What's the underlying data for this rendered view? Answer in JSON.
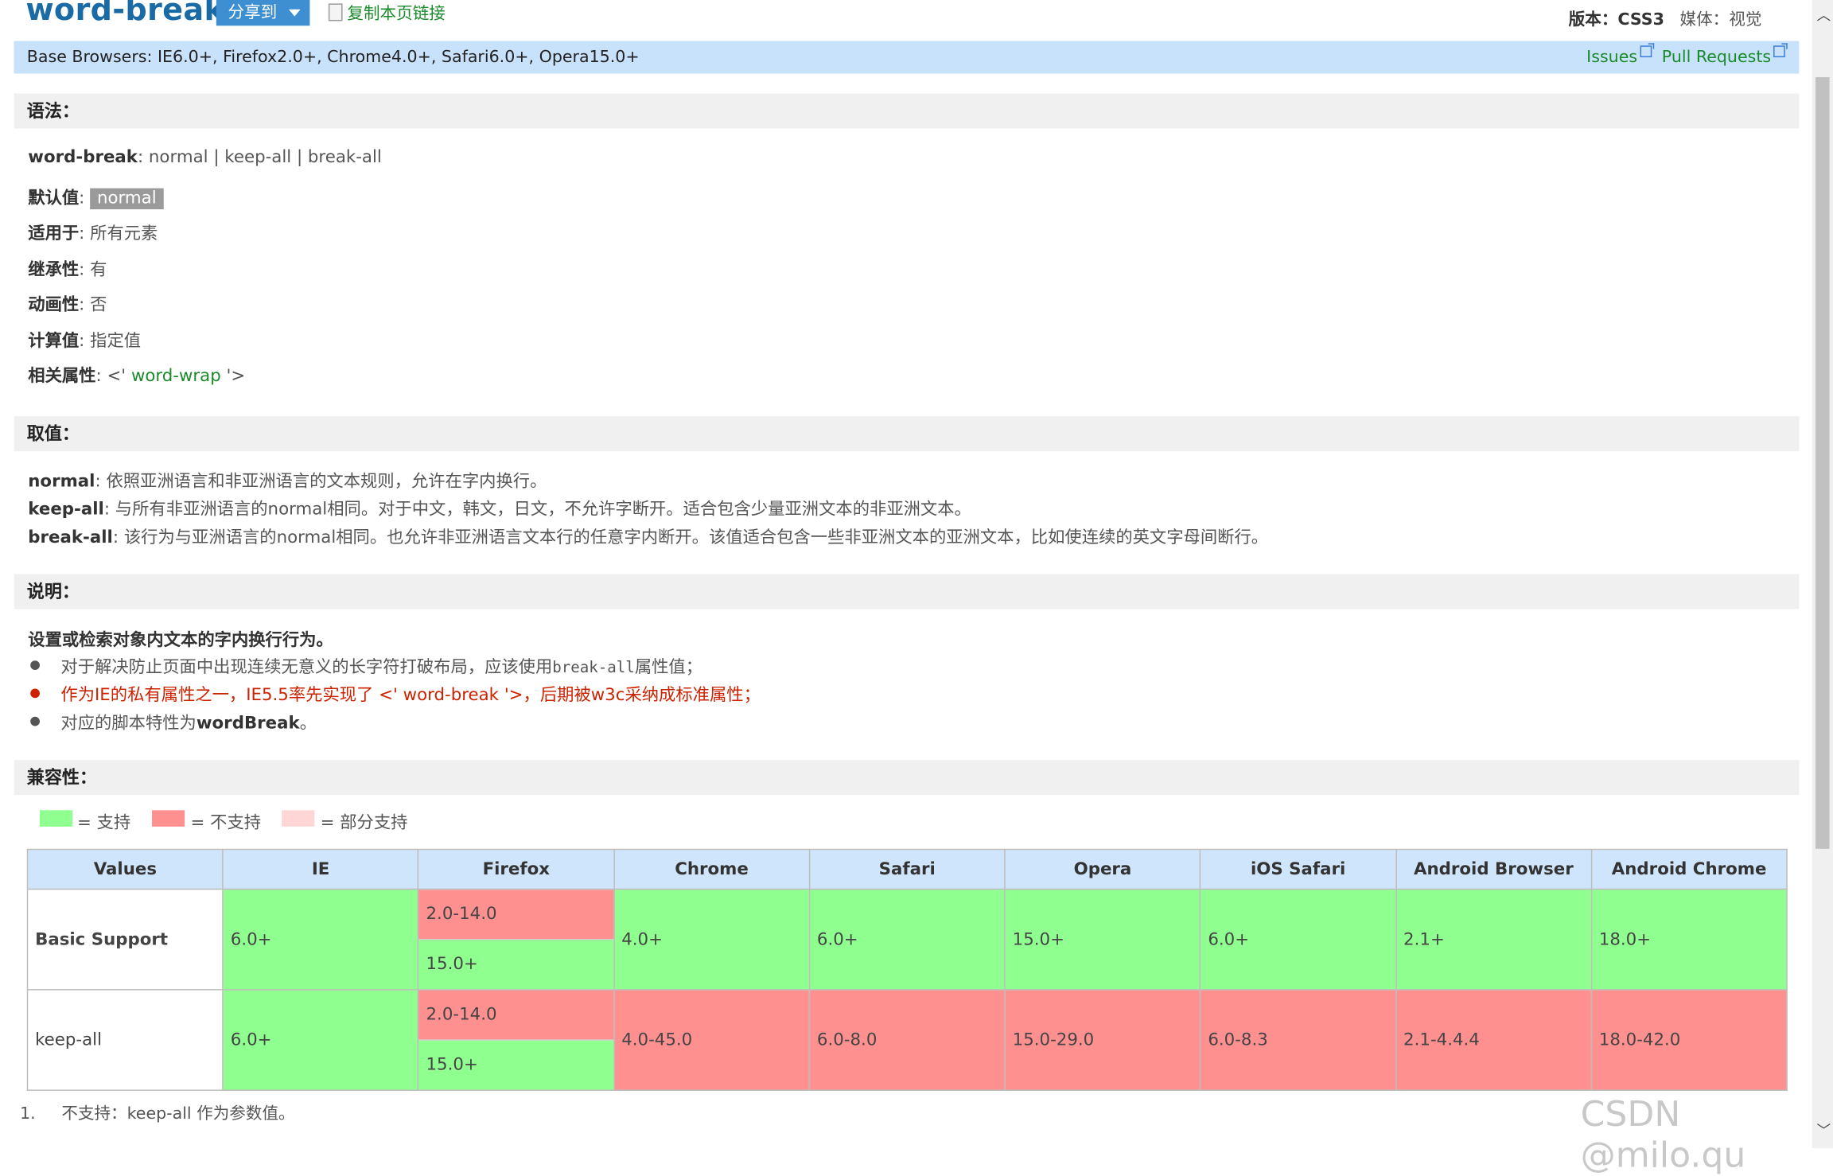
{
  "header": {
    "title": "word-break",
    "share_label": "分享到",
    "copy_link_label": "复制本页链接",
    "version_label": "版本：",
    "version_value": "CSS3",
    "media_label": "媒体：",
    "media_value": "视觉"
  },
  "browser_bar": {
    "base": "Base Browsers: IE6.0+, Firefox2.0+, Chrome4.0+, Safari6.0+, Opera15.0+",
    "issues": "Issues",
    "pull_requests": "Pull Requests"
  },
  "syntax": {
    "heading": "语法：",
    "prop_name": "word-break",
    "prop_values": ": normal | keep-all | break-all",
    "default_label": "默认值",
    "default_value": "normal",
    "applies_label": "适用于",
    "applies_value": "所有元素",
    "inherit_label": "继承性",
    "inherit_value": "有",
    "anim_label": "动画性",
    "anim_value": "否",
    "computed_label": "计算值",
    "computed_value": "指定值",
    "related_label": "相关属性",
    "related_prefix": "<'",
    "related_value": " word-wrap ",
    "related_suffix": "'>"
  },
  "values": {
    "heading": "取值：",
    "items": [
      {
        "name": "normal",
        "desc": "依照亚洲语言和非亚洲语言的文本规则，允许在字内换行。"
      },
      {
        "name": "keep-all",
        "desc": "与所有非亚洲语言的normal相同。对于中文，韩文，日文，不允许字断开。适合包含少量亚洲文本的非亚洲文本。"
      },
      {
        "name": "break-all",
        "desc": "该行为与亚洲语言的normal相同。也允许非亚洲语言文本行的任意字内断开。该值适合包含一些非亚洲文本的亚洲文本，比如使连续的英文字母间断行。"
      }
    ]
  },
  "notes": {
    "heading": "说明：",
    "summary": "设置或检索对象内文本的字内换行行为。",
    "bullet1_a": "对于解决防止页面中出现连续无意义的长字符打破布局，应该使用",
    "bullet1_code": "break-all",
    "bullet1_b": "属性值；",
    "bullet2_a": "作为IE的私有属性之一，IE5.5率先实现了 <' ",
    "bullet2_link": "word-break",
    "bullet2_b": " '>，后期被w3c采纳成标准属性；",
    "bullet3_a": "对应的脚本特性为",
    "bullet3_b": "wordBreak",
    "bullet3_c": "。"
  },
  "compat": {
    "heading": "兼容性：",
    "legend_support": "= 支持",
    "legend_nosupport": "= 不支持",
    "legend_partial": "= 部分支持",
    "color_support": "#8fff8f",
    "color_nosupport": "#ff9090",
    "color_partial": "#ffd6d6",
    "columns": [
      "Values",
      "IE",
      "Firefox",
      "Chrome",
      "Safari",
      "Opera",
      "iOS Safari",
      "Android Browser",
      "Android Chrome"
    ],
    "row1": {
      "label": "Basic Support",
      "ie": "6.0+",
      "ff_top": "2.0-14.0",
      "ff_bottom": "15.0+",
      "chrome": "4.0+",
      "safari": "6.0+",
      "opera": "15.0+",
      "ios": "6.0+",
      "android": "2.1+",
      "achrome": "18.0+"
    },
    "row2": {
      "label": "keep-all",
      "ie": "6.0+",
      "ff_top": "2.0-14.0",
      "ff_bottom": "15.0+",
      "chrome": "4.0-45.0",
      "safari": "6.0-8.0",
      "opera": "15.0-29.0",
      "ios": "6.0-8.3",
      "android": "2.1-4.4.4",
      "achrome": "18.0-42.0"
    }
  },
  "footnote": {
    "num": "1.",
    "text": "不支持：keep-all 作为参数值。"
  },
  "watermark": "CSDN @milo.qu"
}
